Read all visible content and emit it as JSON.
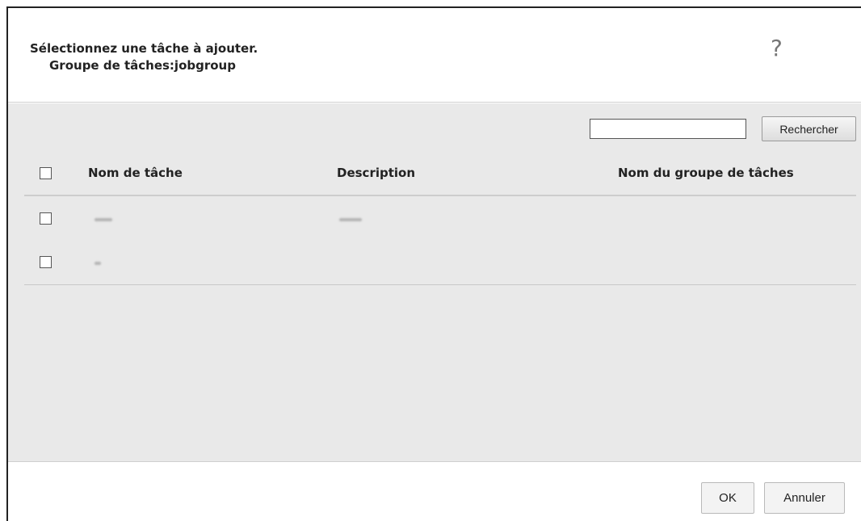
{
  "dialog": {
    "title_line1": "Sélectionnez une tâche à ajouter.",
    "title_line2": "Groupe de tâches:jobgroup",
    "help_glyph": "?"
  },
  "search": {
    "value": "",
    "button_label": "Rechercher"
  },
  "table": {
    "columns": [
      "Nom de tâche",
      "Description",
      "Nom du groupe de tâches"
    ],
    "rows": [
      {
        "name": "",
        "description": "",
        "group": ""
      },
      {
        "name": "",
        "description": "",
        "group": ""
      }
    ]
  },
  "footer": {
    "ok_label": "OK",
    "cancel_label": "Annuler"
  }
}
